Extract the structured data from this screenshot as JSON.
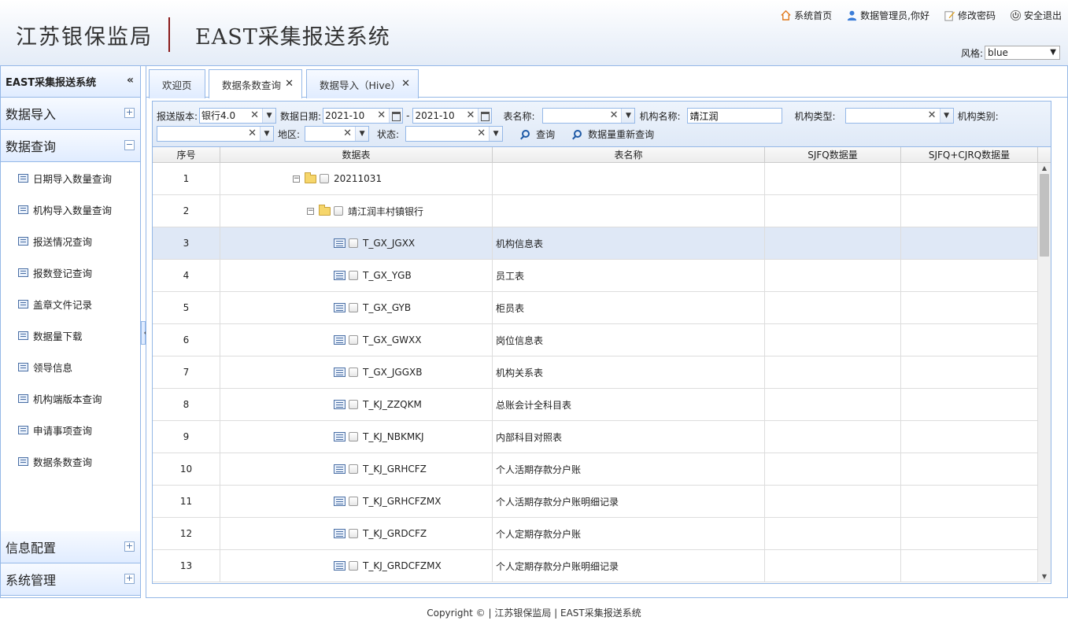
{
  "header": {
    "org_name": "江苏银保监局",
    "system_name": "EAST采集报送系统",
    "links": [
      {
        "label": "系统首页",
        "icon": "home-icon"
      },
      {
        "label": "数据管理员,你好",
        "icon": "user-icon"
      },
      {
        "label": "修改密码",
        "icon": "edit-icon"
      },
      {
        "label": "安全退出",
        "icon": "power-icon"
      }
    ],
    "style_label": "风格:",
    "style_value": "blue"
  },
  "sidebar": {
    "title": "EAST采集报送系统",
    "sections": [
      {
        "label": "数据导入",
        "toggle": "+"
      },
      {
        "label": "数据查询",
        "toggle": "−"
      }
    ],
    "items": [
      {
        "label": "日期导入数量查询"
      },
      {
        "label": "机构导入数量查询"
      },
      {
        "label": "报送情况查询"
      },
      {
        "label": "报数登记查询"
      },
      {
        "label": "盖章文件记录"
      },
      {
        "label": "数据量下载"
      },
      {
        "label": "领导信息"
      },
      {
        "label": "机构端版本查询"
      },
      {
        "label": "申请事项查询"
      },
      {
        "label": "数据条数查询"
      }
    ],
    "bottom_sections": [
      {
        "label": "信息配置",
        "toggle": "+"
      },
      {
        "label": "系统管理",
        "toggle": "+"
      }
    ]
  },
  "tabs": [
    {
      "label": "欢迎页"
    },
    {
      "label": "数据条数查询"
    },
    {
      "label": "数据导入（Hive）"
    }
  ],
  "filters": {
    "version_label": "报送版本:",
    "version_value": "银行4.0",
    "date_label": "数据日期:",
    "date_from": "2021-10",
    "date_sep": "-",
    "date_to": "2021-10",
    "table_name_label": "表名称:",
    "table_name_value": "",
    "org_name_label": "机构名称:",
    "org_name_value": "靖江润",
    "org_type_label": "机构类型:",
    "org_type_value": "",
    "org_category_label": "机构类别:",
    "org_category_value": "",
    "region_label": "地区:",
    "region_value": "",
    "status_label": "状态:",
    "status_value": "",
    "query_button": "查询",
    "requery_button": "数据量重新查询"
  },
  "grid": {
    "columns": [
      "序号",
      "数据表",
      "表名称",
      "SJFQ数据量",
      "SJFQ+CJRQ数据量"
    ],
    "rows": [
      {
        "no": "1",
        "node": "20211031",
        "level": 0,
        "kind": "folder",
        "name": "",
        "sjfq": "",
        "total": ""
      },
      {
        "no": "2",
        "node": "靖江润丰村镇银行",
        "level": 1,
        "kind": "folder",
        "name": "",
        "sjfq": "",
        "total": ""
      },
      {
        "no": "3",
        "node": "T_GX_JGXX",
        "level": 2,
        "kind": "file",
        "name": "机构信息表",
        "sjfq": "",
        "total": ""
      },
      {
        "no": "4",
        "node": "T_GX_YGB",
        "level": 2,
        "kind": "file",
        "name": "员工表",
        "sjfq": "",
        "total": ""
      },
      {
        "no": "5",
        "node": "T_GX_GYB",
        "level": 2,
        "kind": "file",
        "name": "柜员表",
        "sjfq": "",
        "total": ""
      },
      {
        "no": "6",
        "node": "T_GX_GWXX",
        "level": 2,
        "kind": "file",
        "name": "岗位信息表",
        "sjfq": "",
        "total": ""
      },
      {
        "no": "7",
        "node": "T_GX_JGGXB",
        "level": 2,
        "kind": "file",
        "name": "机构关系表",
        "sjfq": "",
        "total": ""
      },
      {
        "no": "8",
        "node": "T_KJ_ZZQKM",
        "level": 2,
        "kind": "file",
        "name": "总账会计全科目表",
        "sjfq": "",
        "total": ""
      },
      {
        "no": "9",
        "node": "T_KJ_NBKMKJ",
        "level": 2,
        "kind": "file",
        "name": "内部科目对照表",
        "sjfq": "",
        "total": ""
      },
      {
        "no": "10",
        "node": "T_KJ_GRHCFZ",
        "level": 2,
        "kind": "file",
        "name": "个人活期存款分户账",
        "sjfq": "",
        "total": ""
      },
      {
        "no": "11",
        "node": "T_KJ_GRHCFZMX",
        "level": 2,
        "kind": "file",
        "name": "个人活期存款分户账明细记录",
        "sjfq": "",
        "total": ""
      },
      {
        "no": "12",
        "node": "T_KJ_GRDCFZ",
        "level": 2,
        "kind": "file",
        "name": "个人定期存款分户账",
        "sjfq": "",
        "total": ""
      },
      {
        "no": "13",
        "node": "T_KJ_GRDCFZMX",
        "level": 2,
        "kind": "file",
        "name": "个人定期存款分户账明细记录",
        "sjfq": "",
        "total": ""
      }
    ],
    "selected_row": 3
  },
  "footer": "Copyright © | 江苏银保监局 | EAST采集报送系统"
}
